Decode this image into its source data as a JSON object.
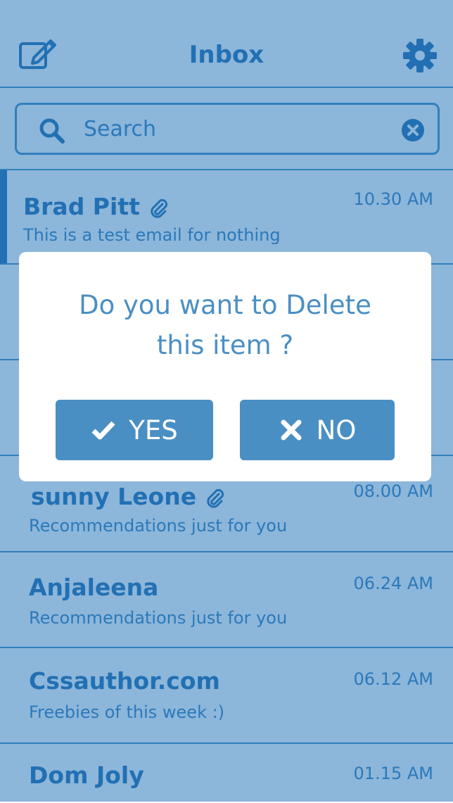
{
  "header": {
    "title": "Inbox",
    "compose_icon": "compose-icon",
    "settings_icon": "gear-icon"
  },
  "search": {
    "placeholder": "Search",
    "value": ""
  },
  "emails": [
    {
      "sender": "Brad Pitt",
      "preview": "This is a test email for nothing",
      "time": "10.30 AM",
      "attachment": true
    },
    {
      "sender": "sunny Leone",
      "preview": "Recommendations just for you",
      "time": "08.00 AM",
      "attachment": true
    },
    {
      "sender": "Anjaleena",
      "preview": "Recommendations just for you",
      "time": "06.24 AM",
      "attachment": false
    },
    {
      "sender": "Cssauthor.com",
      "preview": "Freebies of this week :)",
      "time": "06.12 AM",
      "attachment": false
    },
    {
      "sender": "Dom Joly",
      "preview": "",
      "time": "01.15 AM",
      "attachment": false
    }
  ],
  "dialog": {
    "message_line1": "Do you want to Delete",
    "message_line2": "this item ?",
    "yes_label": "YES",
    "no_label": "NO"
  },
  "colors": {
    "accent": "#2a72b0",
    "overlay": "#1a6eb6",
    "button": "#4a8fc3"
  }
}
